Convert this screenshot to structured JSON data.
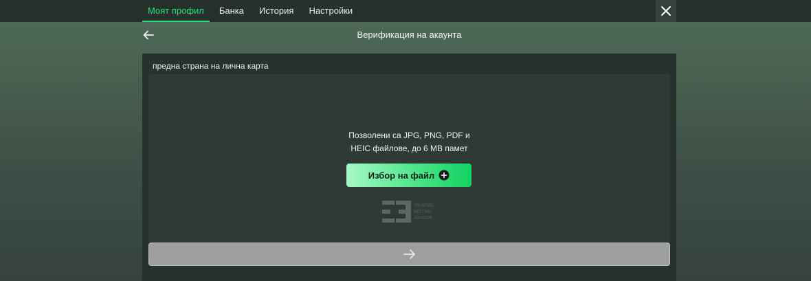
{
  "nav": {
    "tabs": [
      {
        "label": "Моят профил",
        "active": true
      },
      {
        "label": "Банка",
        "active": false
      },
      {
        "label": "История",
        "active": false
      },
      {
        "label": "Настройки",
        "active": false
      }
    ],
    "close_icon": "close-icon"
  },
  "header": {
    "title": "Верификация на акаунта",
    "back_icon": "arrow-left-icon"
  },
  "upload": {
    "section_label": "предна страна на лична карта",
    "allowed_line1": "Позволени са JPG, PNG, PDF и",
    "allowed_line2": "HEIC файлове, до 6 MB памет",
    "choose_button_label": "Избор на файл",
    "choose_button_icon": "plus-circle-icon",
    "trust_logo": {
      "text_line1": "TRUSTED",
      "text_line2": "BETTING",
      "text_line3": "ADVISOR"
    },
    "next_icon": "arrow-right-icon"
  },
  "colors": {
    "accent": "#27e27a",
    "topbar": "#27302d",
    "panel": "#27312d",
    "dropzone": "#2f3935",
    "next_button": "#9d9f9e"
  }
}
